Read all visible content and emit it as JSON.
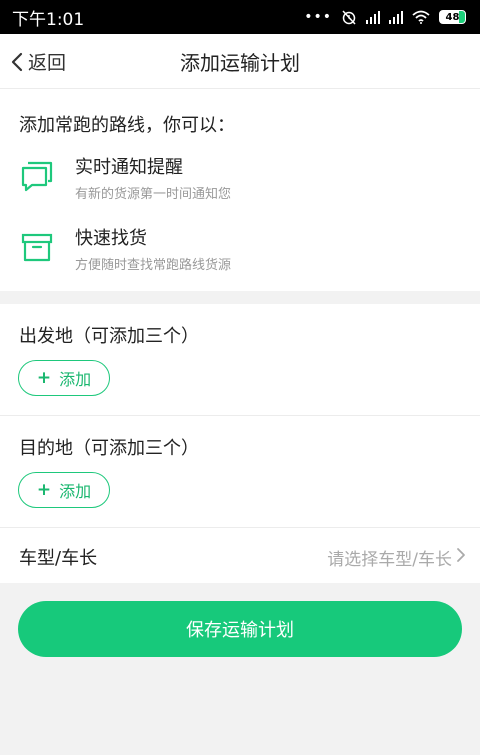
{
  "status_bar": {
    "time": "下午1:01",
    "battery": "48"
  },
  "nav": {
    "back_label": "返回",
    "title": "添加运输计划"
  },
  "intro": {
    "title": "添加常跑的路线，你可以：",
    "features": [
      {
        "icon": "chat-bubbles-icon",
        "title": "实时通知提醒",
        "subtitle": "有新的货源第一时间通知您"
      },
      {
        "icon": "archive-box-icon",
        "title": "快速找货",
        "subtitle": "方便随时查找常跑路线货源"
      }
    ]
  },
  "departure": {
    "label": "出发地（可添加三个）",
    "add_label": "添加"
  },
  "destination": {
    "label": "目的地（可添加三个）",
    "add_label": "添加"
  },
  "vehicle": {
    "label": "车型/车长",
    "placeholder": "请选择车型/车长"
  },
  "save_label": "保存运输计划",
  "colors": {
    "accent": "#17c97b",
    "icon_green": "#1ec87c"
  }
}
